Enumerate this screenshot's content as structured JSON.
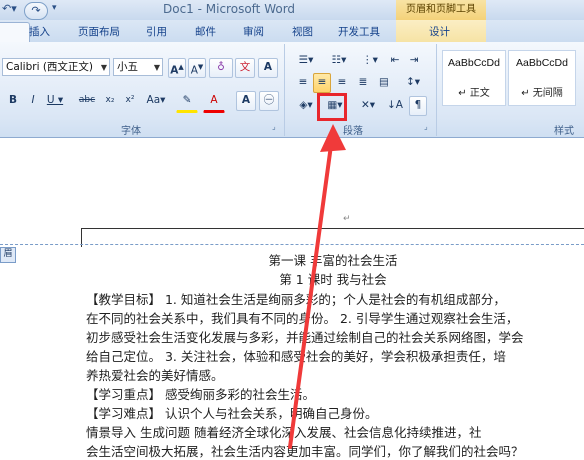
{
  "window": {
    "title": "Doc1 - Microsoft Word",
    "context_header": "页眉和页脚工具"
  },
  "tabs": [
    "插入",
    "页面布局",
    "引用",
    "邮件",
    "审阅",
    "视图",
    "开发工具",
    "设计"
  ],
  "ribbon": {
    "font": {
      "family_value": "Calibri (西文正文)",
      "size_value": "小五",
      "group_label": "字体"
    },
    "paragraph": {
      "group_label": "段落"
    },
    "styles": {
      "group_label": "样式",
      "items": [
        {
          "sample": "AaBbCcDd",
          "name": "正文"
        },
        {
          "sample": "AaBbCcDd",
          "name": "无间隔"
        }
      ]
    }
  },
  "document": {
    "header_tag": "眉",
    "lines": [
      "第一课  丰富的社会生活",
      "第 1 课时  我与社会",
      "【教学目标】  1. 知道社会生活是绚丽多彩的；个人是社会的有机组成部分，",
      "在不同的社会关系中，我们具有不同的身份。  2. 引导学生通过观察社会生活，",
      "初步感受社会生活变化发展与多彩，并能通过绘制自己的社会关系网络图，学会",
      "给自己定位。  3. 关注社会，体验和感受社会的美好，学会积极承担责任，培",
      "养热爱社会的美好情感。",
      "【学习重点】   感受绚丽多彩的社会生活。",
      "【学习难点】   认识个人与社会关系，明确自己身份。",
      "   情景导入  生成问题   随着经济全球化深入发展、社会信息化持续推进，社",
      "会生活空间极大拓展，社会生活内容更加丰富。同学们，你了解我们的社会吗？"
    ]
  },
  "colors": {
    "highlight": "#e8262c",
    "arrow": "#f03a3a"
  }
}
